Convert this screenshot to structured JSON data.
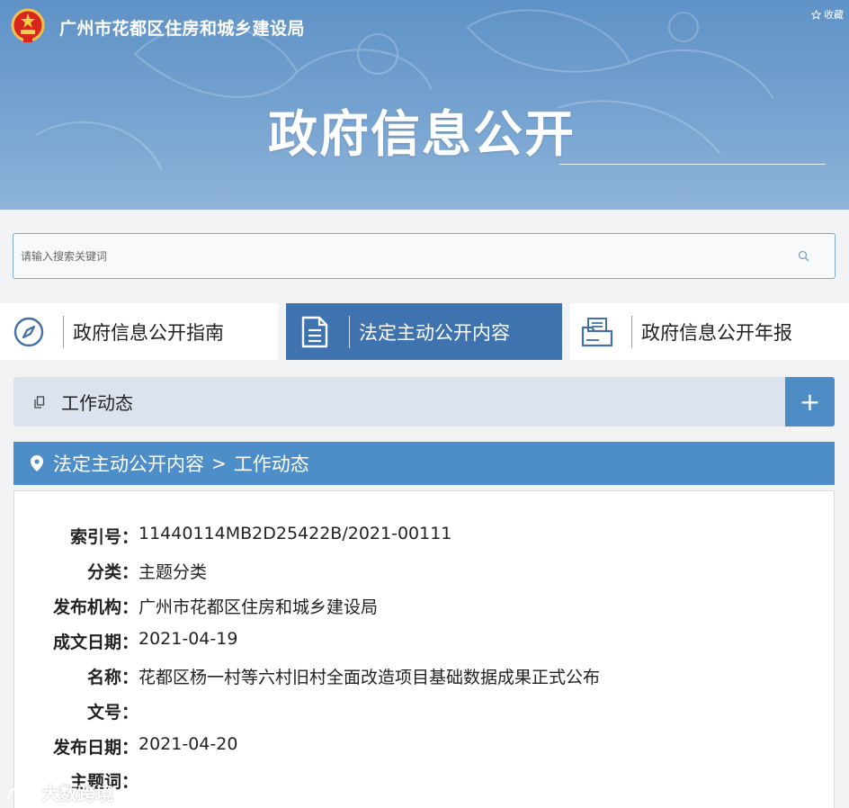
{
  "header": {
    "site_title": "广州市花都区住房和城乡建设局",
    "favorite_label": "收藏",
    "page_title": "政府信息公开"
  },
  "search": {
    "placeholder": "请输入搜索关键词"
  },
  "tabs": [
    {
      "label": "政府信息公开指南",
      "icon": "compass-icon",
      "active": false
    },
    {
      "label": "法定主动公开内容",
      "icon": "document-icon",
      "active": true
    },
    {
      "label": "政府信息公开年报",
      "icon": "folder-icon",
      "active": false
    }
  ],
  "category": {
    "label": "工作动态",
    "expand_label": "+"
  },
  "breadcrumb": {
    "items": [
      "法定主动公开内容",
      "工作动态"
    ],
    "separator": ">"
  },
  "details": [
    {
      "key": "索引号：",
      "value": "11440114MB2D25422B/2021-00111"
    },
    {
      "key": "分类：",
      "value": "主题分类"
    },
    {
      "key": "发布机构：",
      "value": "广州市花都区住房和城乡建设局"
    },
    {
      "key": "成文日期：",
      "value": "2021-04-19"
    },
    {
      "key": "名称：",
      "value": "花都区杨一村等六村旧村全面改造项目基础数据成果正式公布"
    },
    {
      "key": "文号：",
      "value": ""
    },
    {
      "key": "发布日期：",
      "value": "2021-04-20"
    },
    {
      "key": "主题词：",
      "value": ""
    }
  ],
  "watermark": "大数跨境",
  "colors": {
    "banner": "#6e9ccd",
    "active_tab": "#3f73af",
    "breadcrumb_bg": "#4e8ec8",
    "category_bg": "#dbe4ee",
    "plus_button": "#4d8cc5"
  }
}
